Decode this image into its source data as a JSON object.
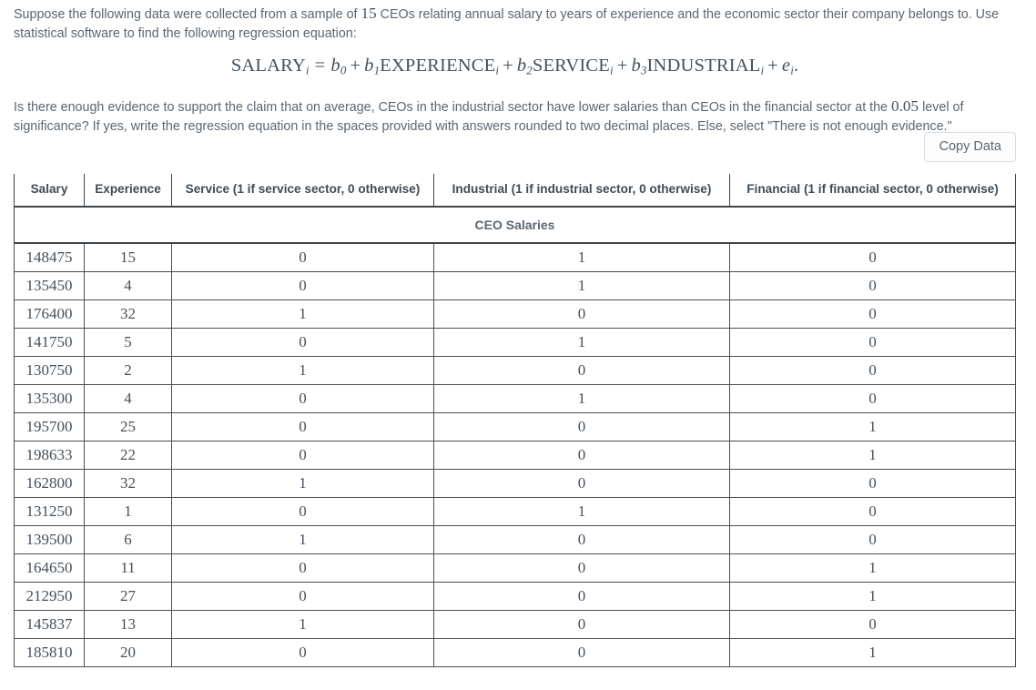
{
  "problem": {
    "paragraph_1_part_a": "Suppose the following data were collected from a sample of ",
    "paragraph_1_sample_size": "15",
    "paragraph_1_part_b": " CEOs relating annual salary to years of experience and the economic sector their company belongs to. Use statistical software to find the following regression equation:",
    "equation": {
      "lhs": "SALARY",
      "lhs_sub": "i",
      "equals": "=",
      "term_intercept_coef": "b",
      "term_intercept_sub": "0",
      "plus": "+",
      "term1_coef": "b",
      "term1_sub": "1",
      "term1_var": "EXPERIENCE",
      "term1_var_sub": "i",
      "term2_coef": "b",
      "term2_sub": "2",
      "term2_var": "SERVICE",
      "term2_var_sub": "i",
      "term3_coef": "b",
      "term3_sub": "3",
      "term3_var": "INDUSTRIAL",
      "term3_var_sub": "i",
      "error": "e",
      "error_sub": "i",
      "period": "."
    },
    "paragraph_3_part_a": "Is there enough evidence to support the claim that on average, CEOs in the industrial sector have lower salaries than CEOs in the financial sector at the ",
    "paragraph_3_alpha": "0.05",
    "paragraph_3_part_b": " level of significance? If yes, write the regression equation in the spaces provided with answers rounded to two decimal places. Else, select \"There is not enough evidence.\""
  },
  "toolbar": {
    "copy_data_label": "Copy Data"
  },
  "table": {
    "caption": "CEO Salaries",
    "headers": [
      "Salary",
      "Experience",
      "Service (1 if service sector, 0 otherwise)",
      "Industrial (1 if industrial sector, 0 otherwise)",
      "Financial (1 if financial sector, 0 otherwise)"
    ],
    "rows": [
      [
        "148475",
        "15",
        "0",
        "1",
        "0"
      ],
      [
        "135450",
        "4",
        "0",
        "1",
        "0"
      ],
      [
        "176400",
        "32",
        "1",
        "0",
        "0"
      ],
      [
        "141750",
        "5",
        "0",
        "1",
        "0"
      ],
      [
        "130750",
        "2",
        "1",
        "0",
        "0"
      ],
      [
        "135300",
        "4",
        "0",
        "1",
        "0"
      ],
      [
        "195700",
        "25",
        "0",
        "0",
        "1"
      ],
      [
        "198633",
        "22",
        "0",
        "0",
        "1"
      ],
      [
        "162800",
        "32",
        "1",
        "0",
        "0"
      ],
      [
        "131250",
        "1",
        "0",
        "1",
        "0"
      ],
      [
        "139500",
        "6",
        "1",
        "0",
        "0"
      ],
      [
        "164650",
        "11",
        "0",
        "0",
        "1"
      ],
      [
        "212950",
        "27",
        "0",
        "0",
        "1"
      ],
      [
        "145837",
        "13",
        "1",
        "0",
        "0"
      ],
      [
        "185810",
        "20",
        "0",
        "0",
        "1"
      ]
    ]
  },
  "colors": {
    "body_text": "#5b6670",
    "math_text": "#44505b",
    "table_border": "#3f4448",
    "button_border": "#d6dde2"
  }
}
